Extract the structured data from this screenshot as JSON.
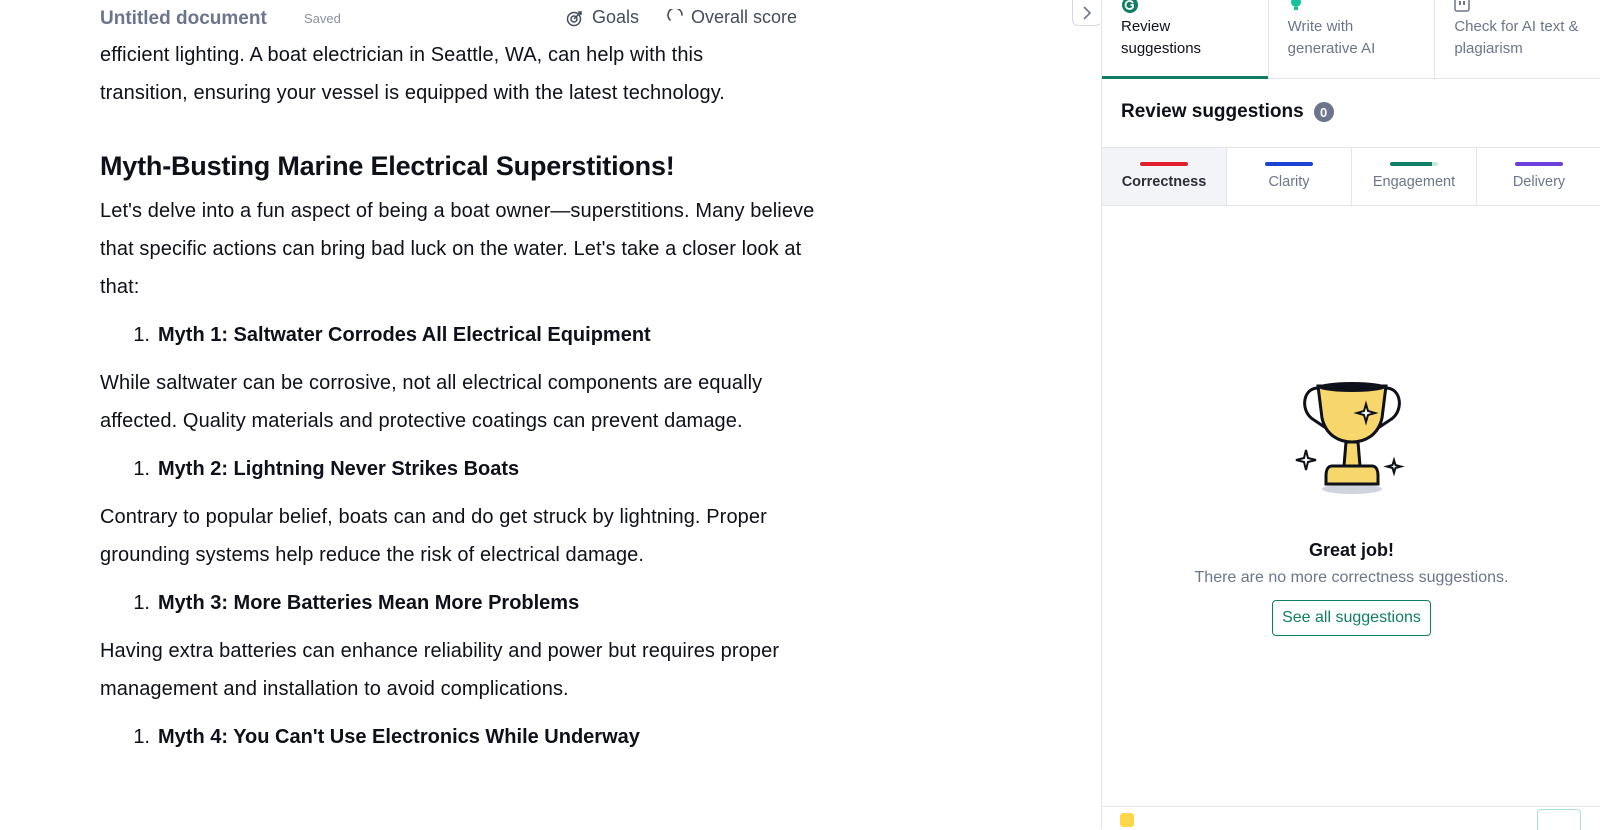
{
  "header": {
    "doc_title": "Untitled document",
    "saved_status": "Saved",
    "goals_label": "Goals",
    "overall_score_label": "Overall score"
  },
  "document": {
    "intro_lines": [
      "efficient lighting. A boat electrician in Seattle, WA, can help with this",
      "transition, ensuring your vessel is equipped with the latest technology."
    ],
    "heading": "Myth-Busting Marine Electrical Superstitions!",
    "lead": "Let's delve into a fun aspect of being a boat owner—superstitions. Many believe that specific actions can bring bad luck on the water. Let's take a closer look at that:",
    "myths": [
      {
        "num": "1.",
        "title": "Myth 1: Saltwater Corrodes All Electrical Equipment",
        "body": "While saltwater can be corrosive, not all electrical components are equally affected. Quality materials and protective coatings can prevent damage."
      },
      {
        "num": "1.",
        "title": "Myth 2: Lightning Never Strikes Boats",
        "body": "Contrary to popular belief, boats can and do get struck by lightning. Proper grounding systems help reduce the risk of electrical damage."
      },
      {
        "num": "1.",
        "title": "Myth 3: More Batteries Mean More Problems",
        "body": "Having extra batteries can enhance reliability and power but requires proper management and installation to avoid complications."
      },
      {
        "num": "1.",
        "title": "Myth 4: You Can't Use Electronics While Underway",
        "body": ""
      }
    ]
  },
  "panel": {
    "tabs": [
      {
        "label": "Review suggestions",
        "icon": "grammarly-g-icon",
        "color": "#0f7e63"
      },
      {
        "label": "Write with generative AI",
        "icon": "lightbulb-icon",
        "color": "#15c39a"
      },
      {
        "label": "Check for AI text & plagiarism",
        "icon": "quote-icon",
        "color": "#6d758d"
      }
    ],
    "title": "Review suggestions",
    "count": "0",
    "categories": [
      {
        "label": "Correctness",
        "color": "#e01e2d"
      },
      {
        "label": "Clarity",
        "color": "#1c44d4"
      },
      {
        "label": "Engagement",
        "color": "#0f7e63"
      },
      {
        "label": "Delivery",
        "color": "#6b3fd9"
      }
    ],
    "empty_state": {
      "icon": "trophy-icon",
      "title": "Great job!",
      "message": "There are no more correctness suggestions.",
      "button": "See all suggestions"
    }
  },
  "colors": {
    "accent": "#0f7e63",
    "text": "#0e101a",
    "muted": "#6d758d"
  }
}
